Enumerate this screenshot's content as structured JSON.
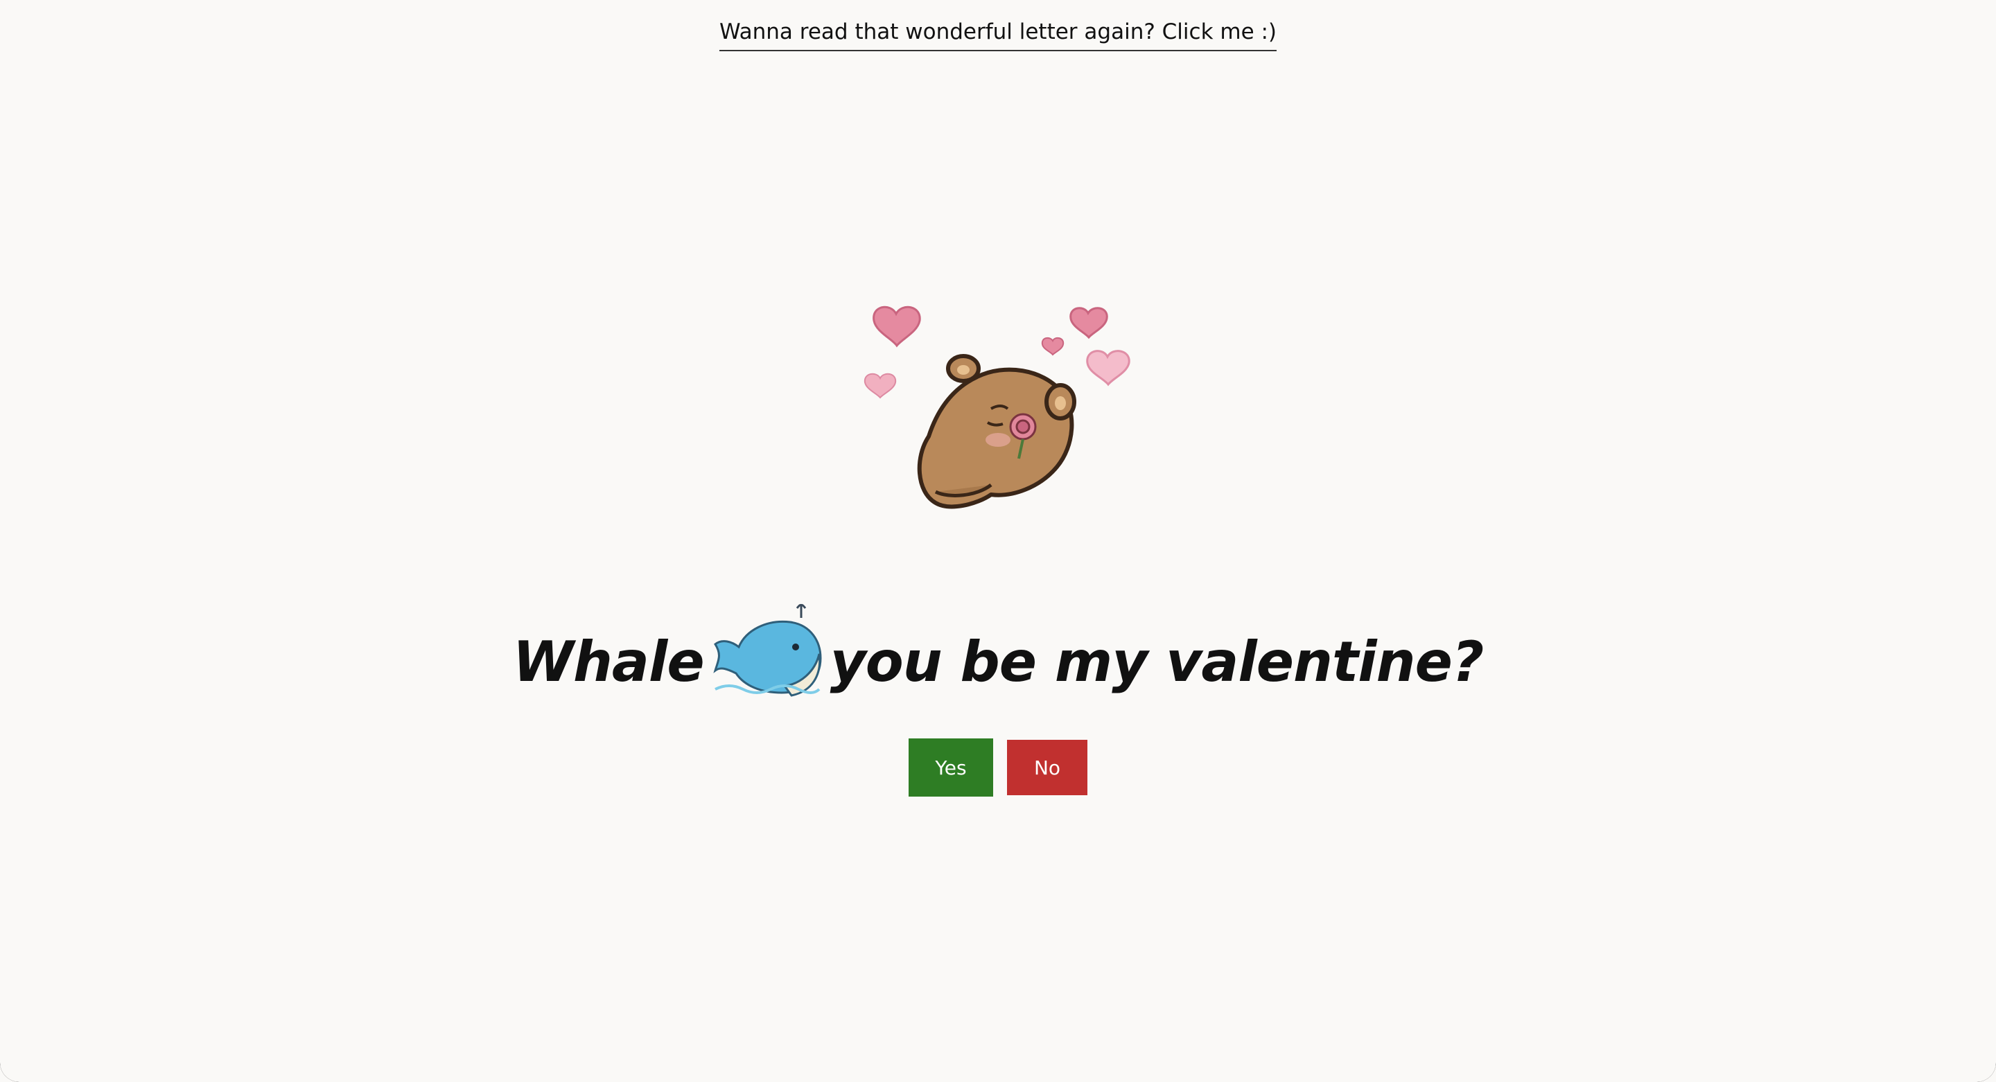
{
  "header": {
    "letter_link": "Wanna read that wonderful letter again? Click me :)"
  },
  "hero": {
    "image": "bear-with-rose-and-hearts",
    "question_left": "Whale",
    "question_icon": "whale-icon",
    "question_right": "you be my valentine?"
  },
  "actions": {
    "yes_label": "Yes",
    "no_label": "No"
  },
  "colors": {
    "background": "#faf9f7",
    "yes": "#2e7d24",
    "no": "#c1302f",
    "heart": "#e58aa0",
    "bear": "#b9895a",
    "whale": "#5ab7df"
  }
}
